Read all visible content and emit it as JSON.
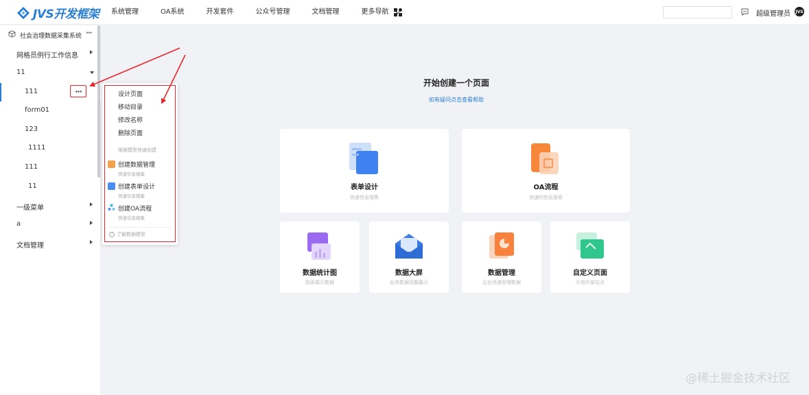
{
  "app": {
    "logo_text": "JVS开发框架",
    "logo_icon": "logo-diamond-icon"
  },
  "nav": {
    "items": [
      "系统管理",
      "OA系统",
      "开发套件",
      "公众号管理",
      "文档管理"
    ],
    "more": "更多导航",
    "user": "超级管理员",
    "avatar_text": "JVS"
  },
  "sidebar": {
    "header": "社会治理数据采集系统",
    "header_more": "···",
    "items": [
      {
        "label": "网格员例行工作信息",
        "caret": "right"
      },
      {
        "label": "11",
        "caret": "down"
      },
      {
        "label": "111",
        "active": true
      },
      {
        "label": "form01"
      },
      {
        "label": "123"
      },
      {
        "label": "1111"
      },
      {
        "label": "111"
      },
      {
        "label": "11"
      },
      {
        "label": "一级菜单",
        "caret": "right"
      },
      {
        "label": "a",
        "caret": "right"
      },
      {
        "label": "文档管理",
        "caret": "right"
      }
    ],
    "more_button": "···"
  },
  "context_menu": {
    "items": [
      "设计页面",
      "移动目录",
      "修改名称",
      "删除页面"
    ],
    "section": "根据模型快速创建",
    "quick": [
      {
        "label": "创建数据管理",
        "sub": "快速信息搜集",
        "color": "#f5a04a"
      },
      {
        "label": "创建表单设计",
        "sub": "快速信息搜集",
        "color": "#4a8ef0"
      },
      {
        "label": "创建OA流程",
        "sub": "快速信息搜集",
        "color": "#38b2d8"
      }
    ],
    "help": "了解数据模型"
  },
  "main": {
    "title": "开始创建一个页面",
    "subtitle": "如有疑问点击查看帮助",
    "cards": [
      {
        "title": "表单设计",
        "desc": "快速信息搜集",
        "icon": "form-design-icon"
      },
      {
        "title": "OA流程",
        "desc": "快速的信息搜索",
        "icon": "oa-flow-icon"
      },
      {
        "title": "数据统计图",
        "desc": "图表展示数据",
        "icon": "chart-icon"
      },
      {
        "title": "数据大屏",
        "desc": "业务数据炫酷展示",
        "icon": "big-screen-icon"
      },
      {
        "title": "数据管理",
        "desc": "后台快速管理数据",
        "icon": "data-manage-icon"
      },
      {
        "title": "自定义页面",
        "desc": "引用外部站点",
        "icon": "custom-page-icon"
      }
    ]
  },
  "watermark": "@稀土掘金技术社区",
  "colors": {
    "accent": "#2a7fd4",
    "highlight": "#e6262a",
    "background": "#f1f2f5"
  }
}
